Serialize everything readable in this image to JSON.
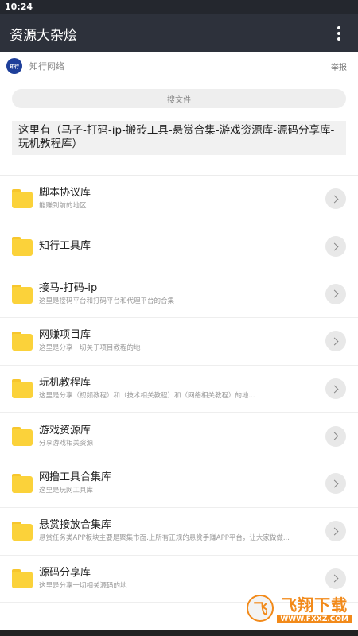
{
  "status": {
    "time": "10:24"
  },
  "app": {
    "title": "资源大杂烩",
    "more_icon": "more-vert-icon"
  },
  "source": {
    "logo_text": "知行",
    "name": "知行网络",
    "report": "举报"
  },
  "search": {
    "placeholder": "搜文件"
  },
  "description": "这里有（马子-打码-ip-搬砖工具-悬赏合集-游戏资源库-源码分享库-玩机教程库）",
  "items": [
    {
      "name": "脚本协议库",
      "sub": "能赚到前的地区"
    },
    {
      "name": "知行工具库",
      "sub": ""
    },
    {
      "name": "接马-打码-ip",
      "sub": "这里是接码平台和打码平台和代理平台的合集"
    },
    {
      "name": "网赚项目库",
      "sub": "这里是分享一切关于项目教程的地"
    },
    {
      "name": "玩机教程库",
      "sub": "这里是分享（视频教程）和（技术相关教程）和（网络相关教程）的地..."
    },
    {
      "name": "游戏资源库",
      "sub": "分享游戏相关资源"
    },
    {
      "name": "网撸工具合集库",
      "sub": "这里是玩网工具库"
    },
    {
      "name": "悬赏接放合集库",
      "sub": "悬赏任务类APP板块主要是聚集市面.上所有正规的悬赏手赚APP平台，让大家做做..."
    },
    {
      "name": "源码分享库",
      "sub": "这里是分享一切相关源码的地"
    }
  ],
  "watermark": {
    "logo_text": "飞",
    "text": "飞翔下载",
    "url": "WWW.FXXZ.COM"
  },
  "colors": {
    "appbar": "#2d313b",
    "statusbar": "#24272e",
    "folder": "#fbd23a",
    "watermark": "#f28a1a"
  }
}
